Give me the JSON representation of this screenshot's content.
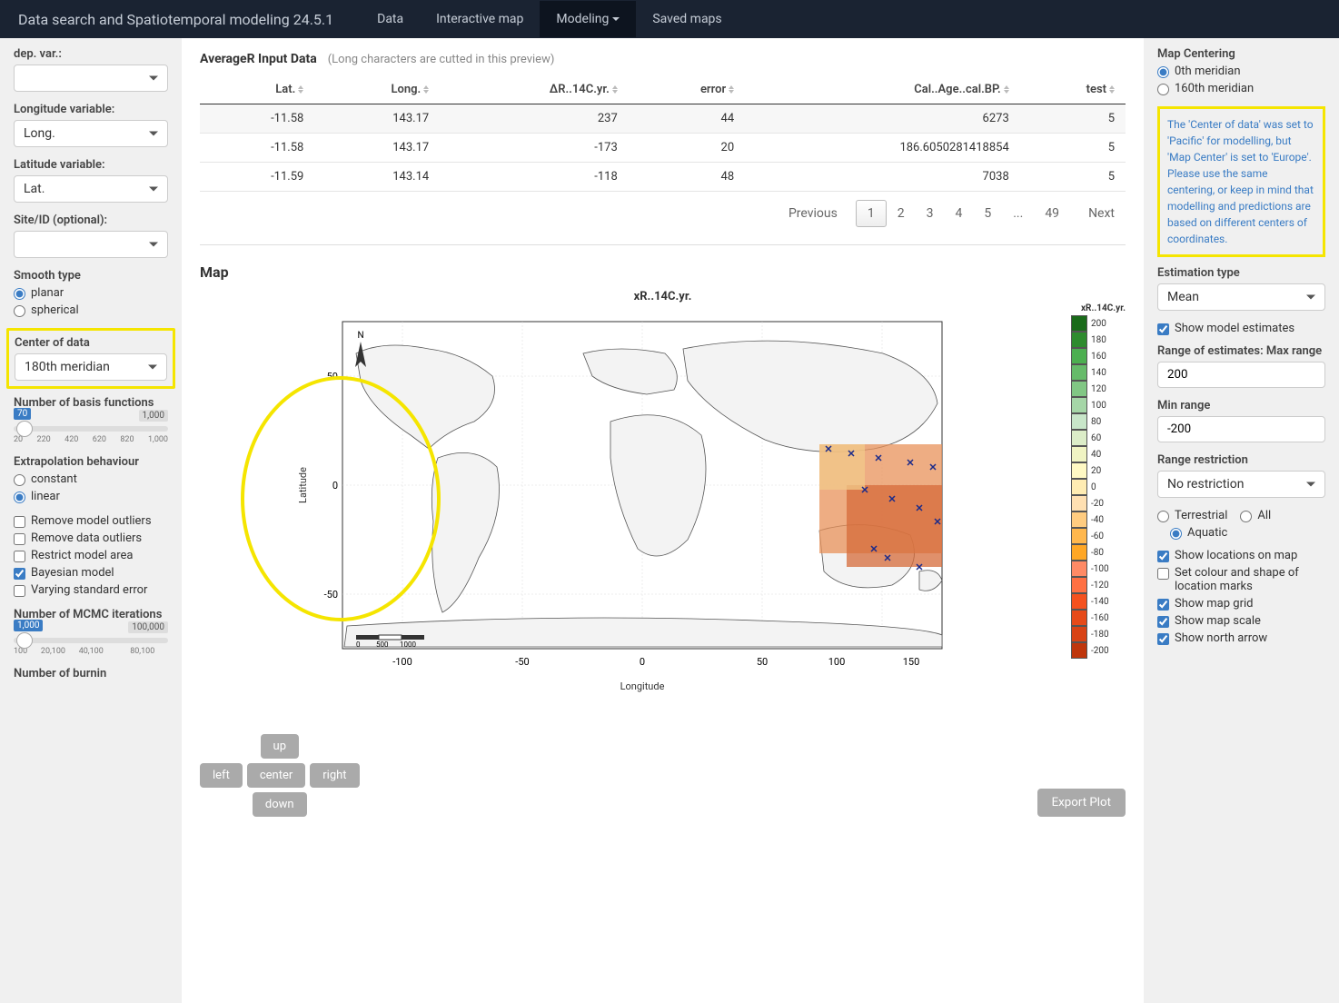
{
  "navbar": {
    "brand": "Data search and Spatiotemporal modeling 24.5.1",
    "items": [
      "Data",
      "Interactive map",
      "Modeling",
      "Saved maps"
    ],
    "active": "Modeling"
  },
  "left": {
    "dep_var_label": "dep. var.:",
    "longitude_label": "Longitude variable:",
    "longitude_value": "Long.",
    "latitude_label": "Latitude variable:",
    "latitude_value": "Lat.",
    "site_id_label": "Site/ID (optional):",
    "smooth_type_label": "Smooth type",
    "smooth_planar": "planar",
    "smooth_spherical": "spherical",
    "center_data_label": "Center of data",
    "center_data_value": "180th meridian",
    "basis_label": "Number of basis functions",
    "basis_value": "70",
    "basis_max": "1,000",
    "basis_ticks": [
      "20",
      "220",
      "420",
      "620",
      "820",
      "1,000"
    ],
    "extrap_label": "Extrapolation behaviour",
    "extrap_constant": "constant",
    "extrap_linear": "linear",
    "remove_model_outliers": "Remove model outliers",
    "remove_data_outliers": "Remove data outliers",
    "restrict_model_area": "Restrict model area",
    "bayesian_model": "Bayesian model",
    "varying_std_error": "Varying standard error",
    "mcmc_label": "Number of MCMC iterations",
    "mcmc_value": "1,000",
    "mcmc_max": "100,000",
    "mcmc_ticks": [
      "100",
      "20,100",
      "40,100",
      "",
      "80,100",
      ""
    ],
    "burnin_label": "Number of burnin"
  },
  "table": {
    "title": "AverageR Input Data",
    "subtitle": "(Long characters are cutted in this preview)",
    "columns": [
      "Lat.",
      "Long.",
      "ΔR..14C.yr.",
      "error",
      "Cal..Age..cal.BP.",
      "test"
    ],
    "rows": [
      [
        "-11.58",
        "143.17",
        "237",
        "44",
        "6273",
        "5"
      ],
      [
        "-11.58",
        "143.17",
        "-173",
        "20",
        "186.6050281418854",
        "5"
      ],
      [
        "-11.59",
        "143.14",
        "-118",
        "48",
        "7038",
        "5"
      ]
    ],
    "pagination": {
      "previous": "Previous",
      "pages": [
        "1",
        "2",
        "3",
        "4",
        "5",
        "...",
        "49"
      ],
      "next": "Next"
    }
  },
  "map": {
    "section_title": "Map",
    "plot_title": "xR..14C.yr.",
    "colorbar_title": "xR..14C.yr.",
    "y_label": "Latitude",
    "x_label": "Longitude",
    "colorbar_values": [
      "200",
      "180",
      "160",
      "140",
      "120",
      "100",
      "80",
      "60",
      "40",
      "20",
      "0",
      "-20",
      "-40",
      "-60",
      "-80",
      "-100",
      "-120",
      "-140",
      "-160",
      "-180",
      "-200"
    ],
    "nav": {
      "up": "up",
      "left": "left",
      "center": "center",
      "right": "right",
      "down": "down"
    },
    "export": "Export Plot"
  },
  "right": {
    "map_centering_label": "Map Centering",
    "meridian_0": "0th meridian",
    "meridian_160": "160th meridian",
    "warning": "The 'Center of data' was set to 'Pacific' for modelling, but 'Map Center' is set to 'Europe'. Please use the same centering, or keep in mind that modelling and predictions are based on different centers of coordinates.",
    "estimation_type_label": "Estimation type",
    "estimation_type_value": "Mean",
    "show_model_estimates": "Show model estimates",
    "range_estimates_label": "Range of estimates: Max range",
    "range_max_value": "200",
    "min_range_label": "Min range",
    "min_range_value": "-200",
    "range_restriction_label": "Range restriction",
    "range_restriction_value": "No restriction",
    "terrestrial": "Terrestrial",
    "all": "All",
    "aquatic": "Aquatic",
    "show_locations": "Show locations on map",
    "set_colour_shape": "Set colour and shape of location marks",
    "show_map_grid": "Show map grid",
    "show_map_scale": "Show map scale",
    "show_north_arrow": "Show north arrow"
  }
}
